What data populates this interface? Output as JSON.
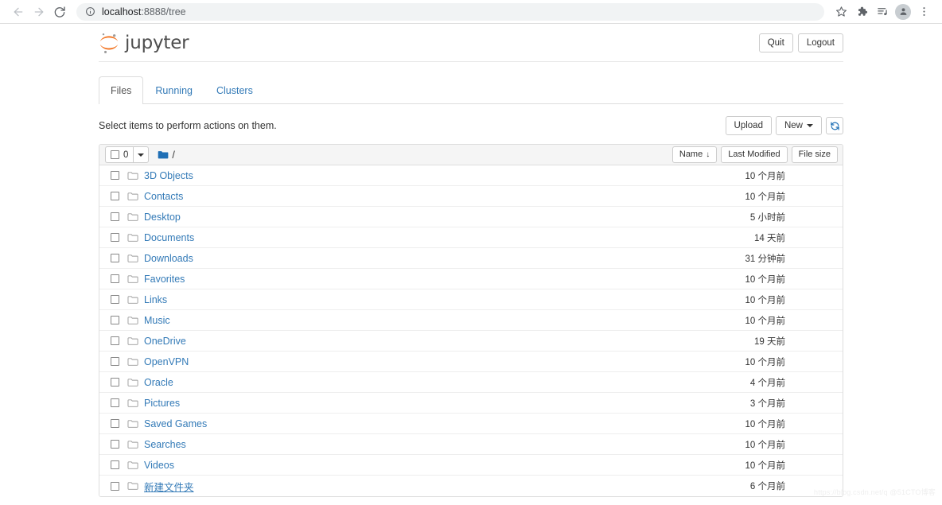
{
  "browser": {
    "back_icon": "arrow-left-icon",
    "forward_icon": "arrow-right-icon",
    "reload_icon": "reload-icon",
    "site_info_icon": "info-circle-icon",
    "url_host": "localhost",
    "url_path": ":8888/tree",
    "url_full": "localhost:8888/tree",
    "actions": [
      {
        "name": "bookmark-star-icon",
        "label": "Bookmark"
      },
      {
        "name": "extensions-puzzle-icon",
        "label": "Extensions"
      },
      {
        "name": "reading-list-icon",
        "label": "Reading list"
      },
      {
        "name": "profile-avatar-icon",
        "label": "Profile"
      },
      {
        "name": "more-menu-icon",
        "label": "Customize and control"
      }
    ]
  },
  "jupyter": {
    "logo_text": "jupyter",
    "logo_color": "#f37726",
    "link_color": "#337ab7",
    "quit_label": "Quit",
    "logout_label": "Logout",
    "tabs": [
      {
        "label": "Files",
        "active": true
      },
      {
        "label": "Running",
        "active": false
      },
      {
        "label": "Clusters",
        "active": false
      }
    ],
    "hint": "Select items to perform actions on them.",
    "upload_label": "Upload",
    "new_label": "New",
    "refresh_icon": "refresh-icon",
    "selected_count": "0",
    "breadcrumb_root": "/",
    "breadcrumb_icon": "folder-icon",
    "columns": {
      "name": "Name",
      "name_sort": "↓",
      "last_modified": "Last Modified",
      "file_size": "File size"
    },
    "files": [
      {
        "name": "3D Objects",
        "modified": "10 个月前",
        "size": "",
        "underlined": false
      },
      {
        "name": "Contacts",
        "modified": "10 个月前",
        "size": "",
        "underlined": false
      },
      {
        "name": "Desktop",
        "modified": "5 小时前",
        "size": "",
        "underlined": false
      },
      {
        "name": "Documents",
        "modified": "14 天前",
        "size": "",
        "underlined": false
      },
      {
        "name": "Downloads",
        "modified": "31 分钟前",
        "size": "",
        "underlined": false
      },
      {
        "name": "Favorites",
        "modified": "10 个月前",
        "size": "",
        "underlined": false
      },
      {
        "name": "Links",
        "modified": "10 个月前",
        "size": "",
        "underlined": false
      },
      {
        "name": "Music",
        "modified": "10 个月前",
        "size": "",
        "underlined": false
      },
      {
        "name": "OneDrive",
        "modified": "19 天前",
        "size": "",
        "underlined": false
      },
      {
        "name": "OpenVPN",
        "modified": "10 个月前",
        "size": "",
        "underlined": false
      },
      {
        "name": "Oracle",
        "modified": "4 个月前",
        "size": "",
        "underlined": false
      },
      {
        "name": "Pictures",
        "modified": "3 个月前",
        "size": "",
        "underlined": false
      },
      {
        "name": "Saved Games",
        "modified": "10 个月前",
        "size": "",
        "underlined": false
      },
      {
        "name": "Searches",
        "modified": "10 个月前",
        "size": "",
        "underlined": false
      },
      {
        "name": "Videos",
        "modified": "10 个月前",
        "size": "",
        "underlined": false
      },
      {
        "name": "新建文件夹",
        "modified": "6 个月前",
        "size": "",
        "underlined": true
      }
    ]
  },
  "watermark": "https://blog.csdn.net/q  @51CTO博客"
}
